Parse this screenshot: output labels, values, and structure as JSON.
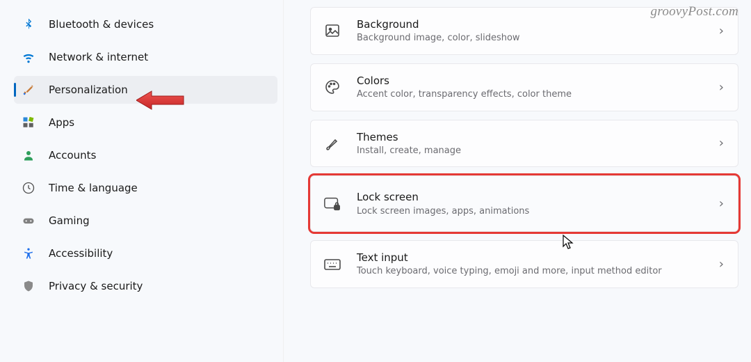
{
  "watermark": "groovyPost.com",
  "sidebar": {
    "items": [
      {
        "label": "Bluetooth & devices"
      },
      {
        "label": "Network & internet"
      },
      {
        "label": "Personalization"
      },
      {
        "label": "Apps"
      },
      {
        "label": "Accounts"
      },
      {
        "label": "Time & language"
      },
      {
        "label": "Gaming"
      },
      {
        "label": "Accessibility"
      },
      {
        "label": "Privacy & security"
      }
    ]
  },
  "main": {
    "cards": [
      {
        "title": "Background",
        "sub": "Background image, color, slideshow"
      },
      {
        "title": "Colors",
        "sub": "Accent color, transparency effects, color theme"
      },
      {
        "title": "Themes",
        "sub": "Install, create, manage"
      },
      {
        "title": "Lock screen",
        "sub": "Lock screen images, apps, animations"
      },
      {
        "title": "Text input",
        "sub": "Touch keyboard, voice typing, emoji and more, input method editor"
      }
    ]
  }
}
